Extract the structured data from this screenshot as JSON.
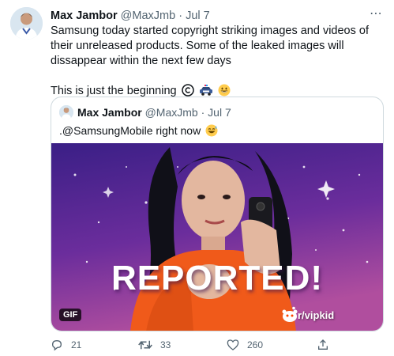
{
  "tweet": {
    "display_name": "Max Jambor",
    "handle": "@MaxJmb",
    "separator": "·",
    "date": "Jul 7",
    "text_line1": "Samsung today started copyright striking images and videos of their unreleased products. Some of the leaked images will dissappear within the next few days",
    "text_line2": "This is just the beginning",
    "emojis": [
      "copyright-icon",
      "police-car-icon",
      "grinning-face-icon"
    ]
  },
  "quoted_tweet": {
    "display_name": "Max Jambor",
    "handle": "@MaxJmb",
    "separator": "·",
    "date": "Jul 7",
    "text": ".@SamsungMobile right now",
    "emoji": "sweat-smile-icon",
    "media": {
      "overlay_text": "REPORTED!",
      "badge": "GIF",
      "watermark": "r/vipkid"
    }
  },
  "actions": {
    "reply_count": "21",
    "retweet_count": "33",
    "like_count": "260"
  },
  "colors": {
    "text": "#0f1419",
    "muted": "#536471",
    "border": "#cfd9de",
    "gif_bg_top": "#3a1f86",
    "gif_bg_bottom": "#b04e9e"
  }
}
